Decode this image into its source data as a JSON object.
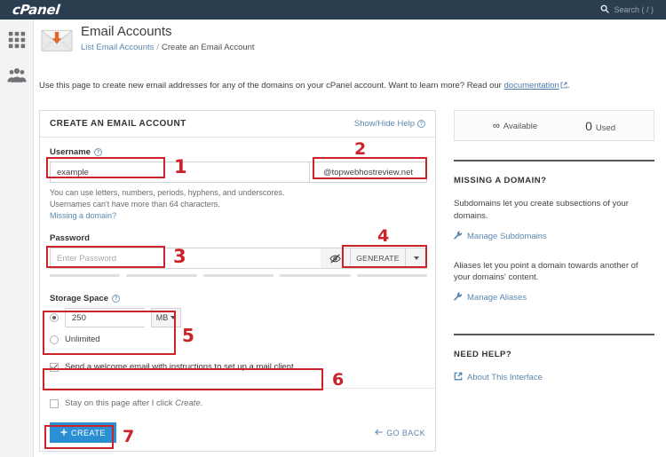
{
  "topbar": {
    "logo": "cPanel",
    "search_placeholder": "Search ( / )",
    "search_icon": "search-icon"
  },
  "rail": {
    "items": [
      {
        "icon": "apps-grid-icon",
        "name": "apps"
      },
      {
        "icon": "users-icon",
        "name": "users"
      }
    ]
  },
  "page": {
    "title": "Email Accounts",
    "icon": "email-envelope-arrow-icon",
    "breadcrumb": {
      "parent": "List Email Accounts",
      "separator": "/",
      "current": "Create an Email Account"
    },
    "intro_before": "Use this page to create new email addresses for any of the domains on your cPanel account. Want to learn more? Read our ",
    "intro_link": "documentation",
    "intro_after": "."
  },
  "form": {
    "heading": "CREATE AN EMAIL ACCOUNT",
    "help_toggle": "Show/Hide Help",
    "username": {
      "label": "Username",
      "value": "example",
      "placeholder": "example",
      "domain": "@topwebhostreview.net",
      "hint_line1": "You can use letters, numbers, periods, hyphens, and underscores.",
      "hint_line2": "Usernames can't have more than 64 characters.",
      "hint_link": "Missing a domain?"
    },
    "password": {
      "label": "Password",
      "placeholder": "Enter Password",
      "value": "",
      "toggle_icon": "eye-slash-icon",
      "generate_label": "GENERATE",
      "caret_icon": "chevron-down-icon",
      "strength_segments": 5
    },
    "storage": {
      "label": "Storage Space",
      "quota_value": "250",
      "unit": "MB",
      "unit_caret_icon": "chevron-down-icon",
      "unlimited_label": "Unlimited",
      "selected": "quota"
    },
    "welcome_checkbox": {
      "label": "Send a welcome email with instructions to set up a mail client.",
      "checked": true
    },
    "stay_checkbox": {
      "label_before": "Stay on this page after I click ",
      "label_em": "Create",
      "label_after": ".",
      "checked": false
    },
    "create_button": {
      "label": "CREATE",
      "icon": "plus-icon"
    },
    "go_back": {
      "label": "GO BACK",
      "icon": "arrow-left-icon"
    }
  },
  "sidebar": {
    "stats": [
      {
        "value": "∞",
        "label": "Available"
      },
      {
        "value": "0",
        "label": "Used"
      }
    ],
    "missing_domain": {
      "heading": "MISSING A DOMAIN?",
      "subdomain_text": "Subdomains let you create subsections of your domains.",
      "subdomain_link": "Manage Subdomains",
      "alias_text": "Aliases let you point a domain towards another of your domains' content.",
      "alias_link": "Manage Aliases",
      "link_icon": "wrench-icon"
    },
    "need_help": {
      "heading": "NEED HELP?",
      "link": "About This Interface",
      "link_icon": "external-link-icon"
    }
  },
  "annotations": {
    "color": "#cc2229",
    "markers": [
      {
        "id": "1",
        "target": "username-input"
      },
      {
        "id": "2",
        "target": "domain-suffix"
      },
      {
        "id": "3",
        "target": "password-input"
      },
      {
        "id": "4",
        "target": "generate-button"
      },
      {
        "id": "5",
        "target": "storage-options"
      },
      {
        "id": "6",
        "target": "welcome-email-checkbox"
      },
      {
        "id": "7",
        "target": "create-button"
      }
    ]
  }
}
